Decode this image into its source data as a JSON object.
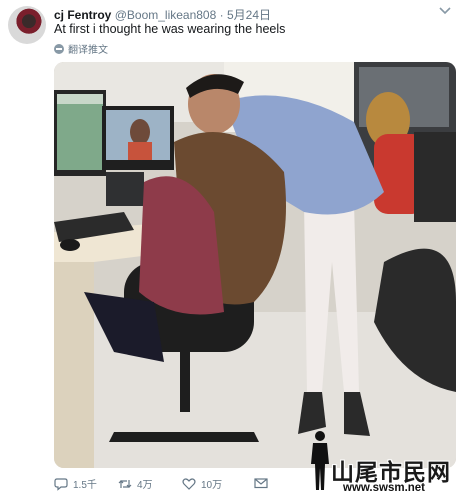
{
  "tweet": {
    "display_name": "cj Fentroy",
    "handle": "@Boom_likean808",
    "separator": "·",
    "date": "5月24日",
    "text": "At first i thought he was wearing the heels",
    "translate_label": "翻译推文",
    "menu_icon": "chevron-down-icon"
  },
  "actions": {
    "reply": {
      "icon": "reply-icon",
      "count": "1.5千"
    },
    "retweet": {
      "icon": "retweet-icon",
      "count": "4万"
    },
    "like": {
      "icon": "heart-icon",
      "count": "10万"
    },
    "dm": {
      "icon": "envelope-icon"
    }
  },
  "watermark": {
    "text": "山尾市民网",
    "url": "www.swsm.net"
  },
  "colors": {
    "text_primary": "#14171a",
    "text_secondary": "#657786",
    "background": "#ffffff"
  }
}
